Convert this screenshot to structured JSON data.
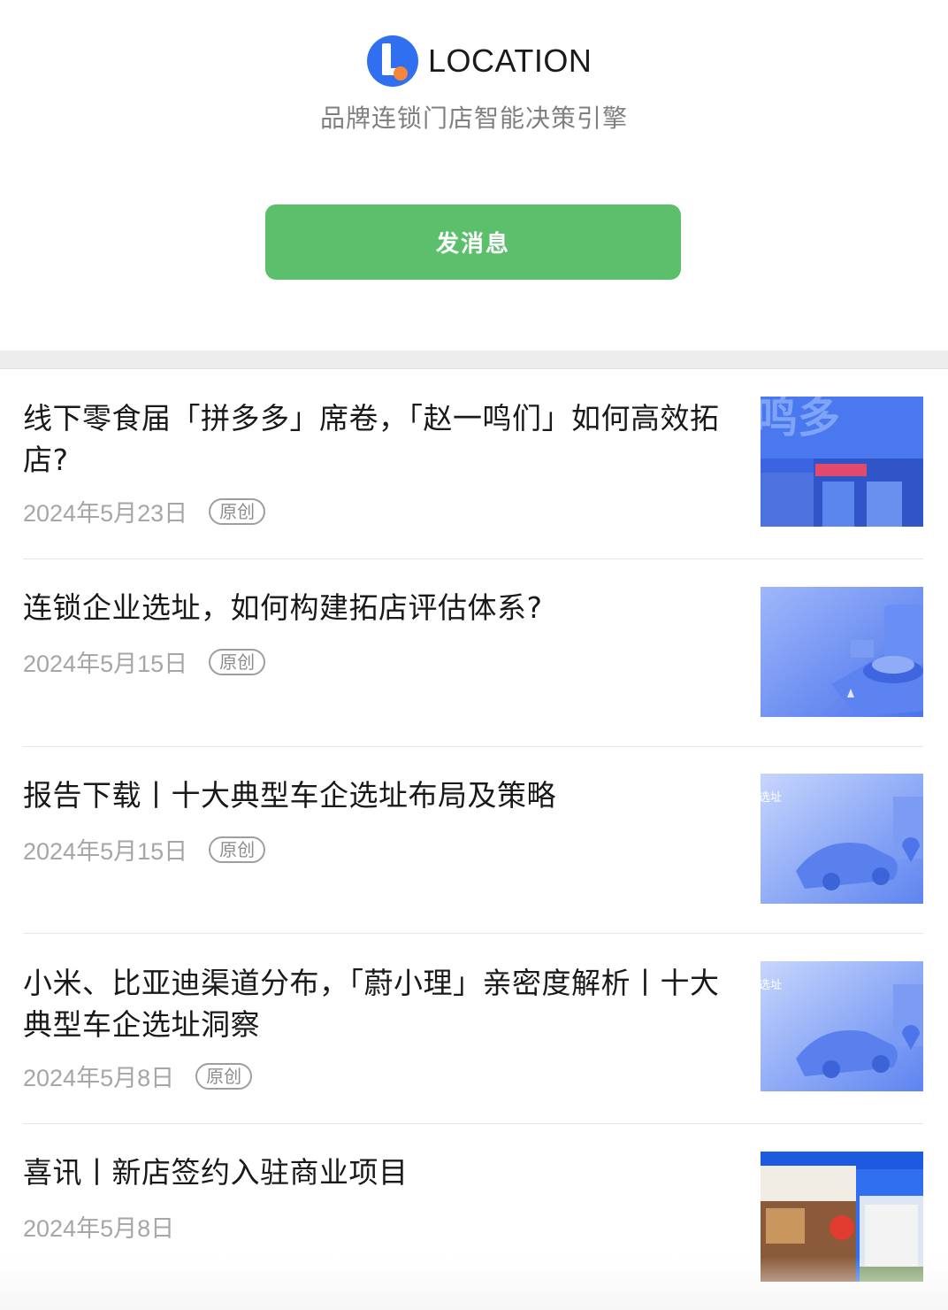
{
  "header": {
    "brand_name": "LOCATION",
    "slogan": "品牌连锁门店智能决策引擎",
    "message_button": "发消息"
  },
  "colors": {
    "accent_green": "#5bbf6c",
    "logo_blue": "#2f6ff0",
    "logo_orange": "#f5873a"
  },
  "articles": [
    {
      "title": "线下零食届「拼多多」席卷，「赵一鸣们」如何高效拓店?",
      "date": "2024年5月23日",
      "tag": "原创",
      "thumb_text": "鸣多"
    },
    {
      "title": "连锁企业选址，如何构建拓店评估体系?",
      "date": "2024年5月15日",
      "tag": "原创"
    },
    {
      "title": "报告下载丨十大典型车企选址布局及策略",
      "date": "2024年5月15日",
      "tag": "原创",
      "thumb_text": "选址"
    },
    {
      "title": "小米、比亚迪渠道分布，「蔚小理」亲密度解析丨十大典型车企选址洞察",
      "date": "2024年5月8日",
      "tag": "原创",
      "thumb_text": "选址"
    },
    {
      "title": "喜讯丨新店签约入驻商业项目",
      "date": "2024年5月8日"
    }
  ]
}
